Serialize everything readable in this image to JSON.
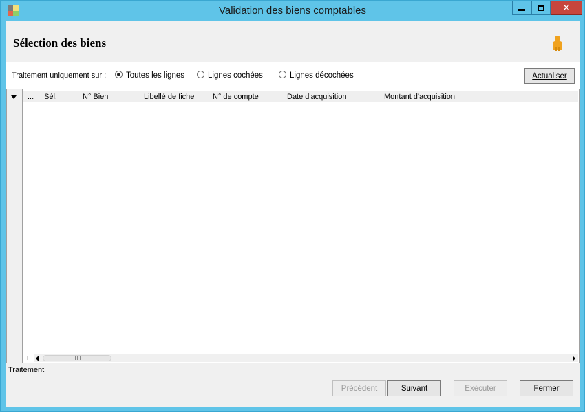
{
  "window": {
    "title": "Validation des biens comptables",
    "minimize_label": "",
    "maximize_label": "",
    "close_label": "✕",
    "accent_color": "#5fc4e8",
    "close_color": "#c7463d"
  },
  "header": {
    "title": "Sélection des biens",
    "user_icon": "user-icon"
  },
  "filter": {
    "label": "Traitement uniquement sur :",
    "options": [
      {
        "label": "Toutes les lignes",
        "selected": true
      },
      {
        "label": "Lignes cochées",
        "selected": false
      },
      {
        "label": "Lignes décochées",
        "selected": false
      }
    ],
    "refresh_label": "Actualiser"
  },
  "grid": {
    "columns": [
      "...",
      "Sél.",
      "N° Bien",
      "Libellé de fiche",
      "N° de compte",
      "Date d'acquisition",
      "Montant d'acquisition"
    ],
    "rows": [],
    "add_label": "+"
  },
  "footer": {
    "group_label": "Traitement",
    "buttons": {
      "previous": "Précédent",
      "next": "Suivant",
      "execute": "Exécuter",
      "close": "Fermer"
    }
  }
}
